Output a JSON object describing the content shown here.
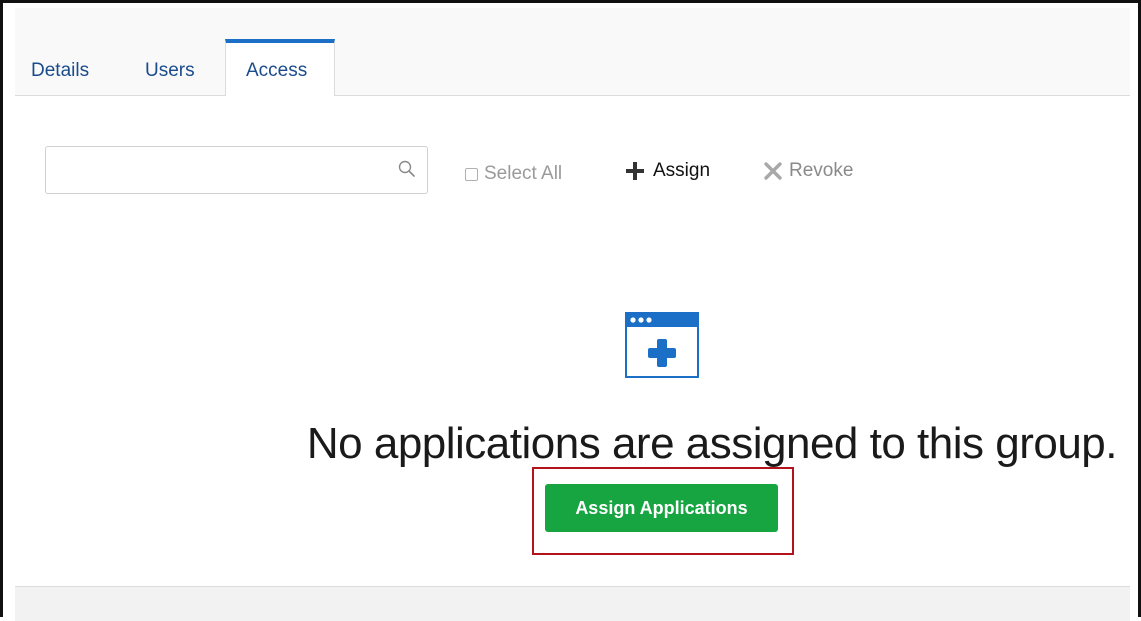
{
  "tabs": {
    "details_label": "Details",
    "users_label": "Users",
    "access_label": "Access",
    "active": "Access"
  },
  "toolbar": {
    "search": {
      "value": "",
      "placeholder": ""
    },
    "select_all_label": "Select All",
    "select_all_checked": false,
    "assign_label": "Assign",
    "revoke_label": "Revoke"
  },
  "empty_state": {
    "icon": "app-window-plus-icon",
    "message": "No applications are assigned to this group.",
    "button_label": "Assign Applications"
  },
  "colors": {
    "accent_blue": "#1c6fc7",
    "tab_text": "#1a4c8c",
    "primary_button": "#17a541",
    "highlight_border": "#b3141b"
  }
}
